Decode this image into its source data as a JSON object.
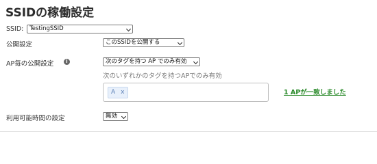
{
  "page": {
    "title": "SSIDの稼働設定"
  },
  "form": {
    "ssid": {
      "label": "SSID:",
      "value": "TestingSSID"
    },
    "visibility": {
      "label": "公開設定",
      "value": "このSSIDを公開する"
    },
    "per_ap": {
      "label": "AP毎の公開設定",
      "info_glyph": "i",
      "value": "次のタグを持つ AP でのみ有効",
      "hint": "次のいずれかのタグを持つAPでのみ有効",
      "tags": [
        {
          "text": "A",
          "remove": "x"
        }
      ],
      "match_link": "1 APが一致しました"
    },
    "schedule": {
      "label": "利用可能時間の設定",
      "value": "無効"
    }
  },
  "colors": {
    "link_green": "#2a8a2a",
    "chip_bg": "#e8f0fb",
    "chip_text": "#5b7fb5"
  },
  "icons": {
    "info": "info-circle-icon",
    "dropdown": "chevron-down-icon",
    "remove": "close-icon"
  }
}
